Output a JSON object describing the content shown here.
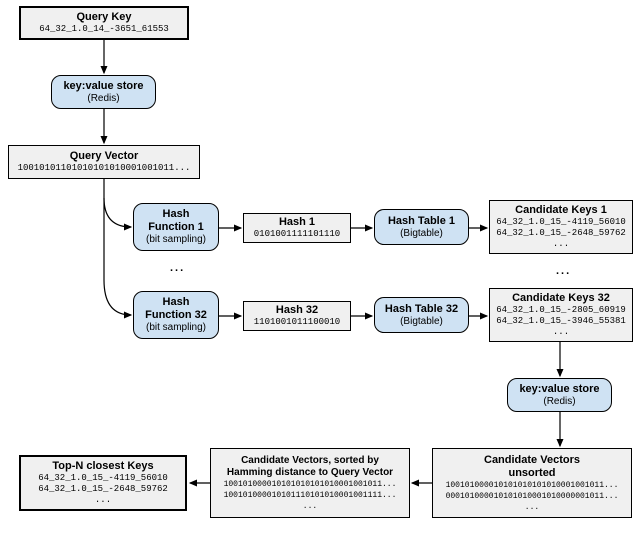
{
  "query_key": {
    "title": "Query Key",
    "value": "64_32_1.0_14_-3651_61553"
  },
  "kv_store": {
    "title": "key:value store",
    "sub": "(Redis)"
  },
  "query_vector": {
    "title": "Query Vector",
    "value": "10010101101010101010001001011..."
  },
  "hash_fn_1": {
    "title": "Hash",
    "title2": "Function 1",
    "sub": "(bit sampling)"
  },
  "hash_fn_32": {
    "title": "Hash",
    "title2": "Function 32",
    "sub": "(bit sampling)"
  },
  "hash_1": {
    "title": "Hash 1",
    "value": "0101001111101110"
  },
  "hash_32": {
    "title": "Hash 32",
    "value": "1101001011100010"
  },
  "hash_table_1": {
    "title": "Hash Table 1",
    "sub": "(Bigtable)"
  },
  "hash_table_32": {
    "title": "Hash Table 32",
    "sub": "(Bigtable)"
  },
  "cand_keys_1": {
    "title": "Candidate Keys 1",
    "v1": "64_32_1.0_15_-4119_56010",
    "v2": "64_32_1.0_15_-2648_59762",
    "ell": "..."
  },
  "cand_keys_32": {
    "title": "Candidate Keys 32",
    "v1": "64_32_1.0_15_-2805_60919",
    "v2": "64_32_1.0_15_-3946_55381",
    "ell": "..."
  },
  "kv_store_2": {
    "title": "key:value store",
    "sub": "(Redis)"
  },
  "cand_vec_unsorted": {
    "title": "Candidate Vectors",
    "title2": "unsorted",
    "v1": "100101000010101010101010001001011...",
    "v2": "000101000010101010001010000001011...",
    "ell": "..."
  },
  "cand_vec_sorted": {
    "l1": "Candidate Vectors, sorted by",
    "l2": "Hamming distance to Query Vector",
    "v1": "100101000010101010101010001001011...",
    "v2": "100101000010101110101010001001111...",
    "ell": "..."
  },
  "topn": {
    "title": "Top-N closest Keys",
    "v1": "64_32_1.0_15_-4119_56010",
    "v2": "64_32_1.0_15_-2648_59762",
    "ell": "..."
  },
  "ell_mid": "...",
  "ell_right": "..."
}
